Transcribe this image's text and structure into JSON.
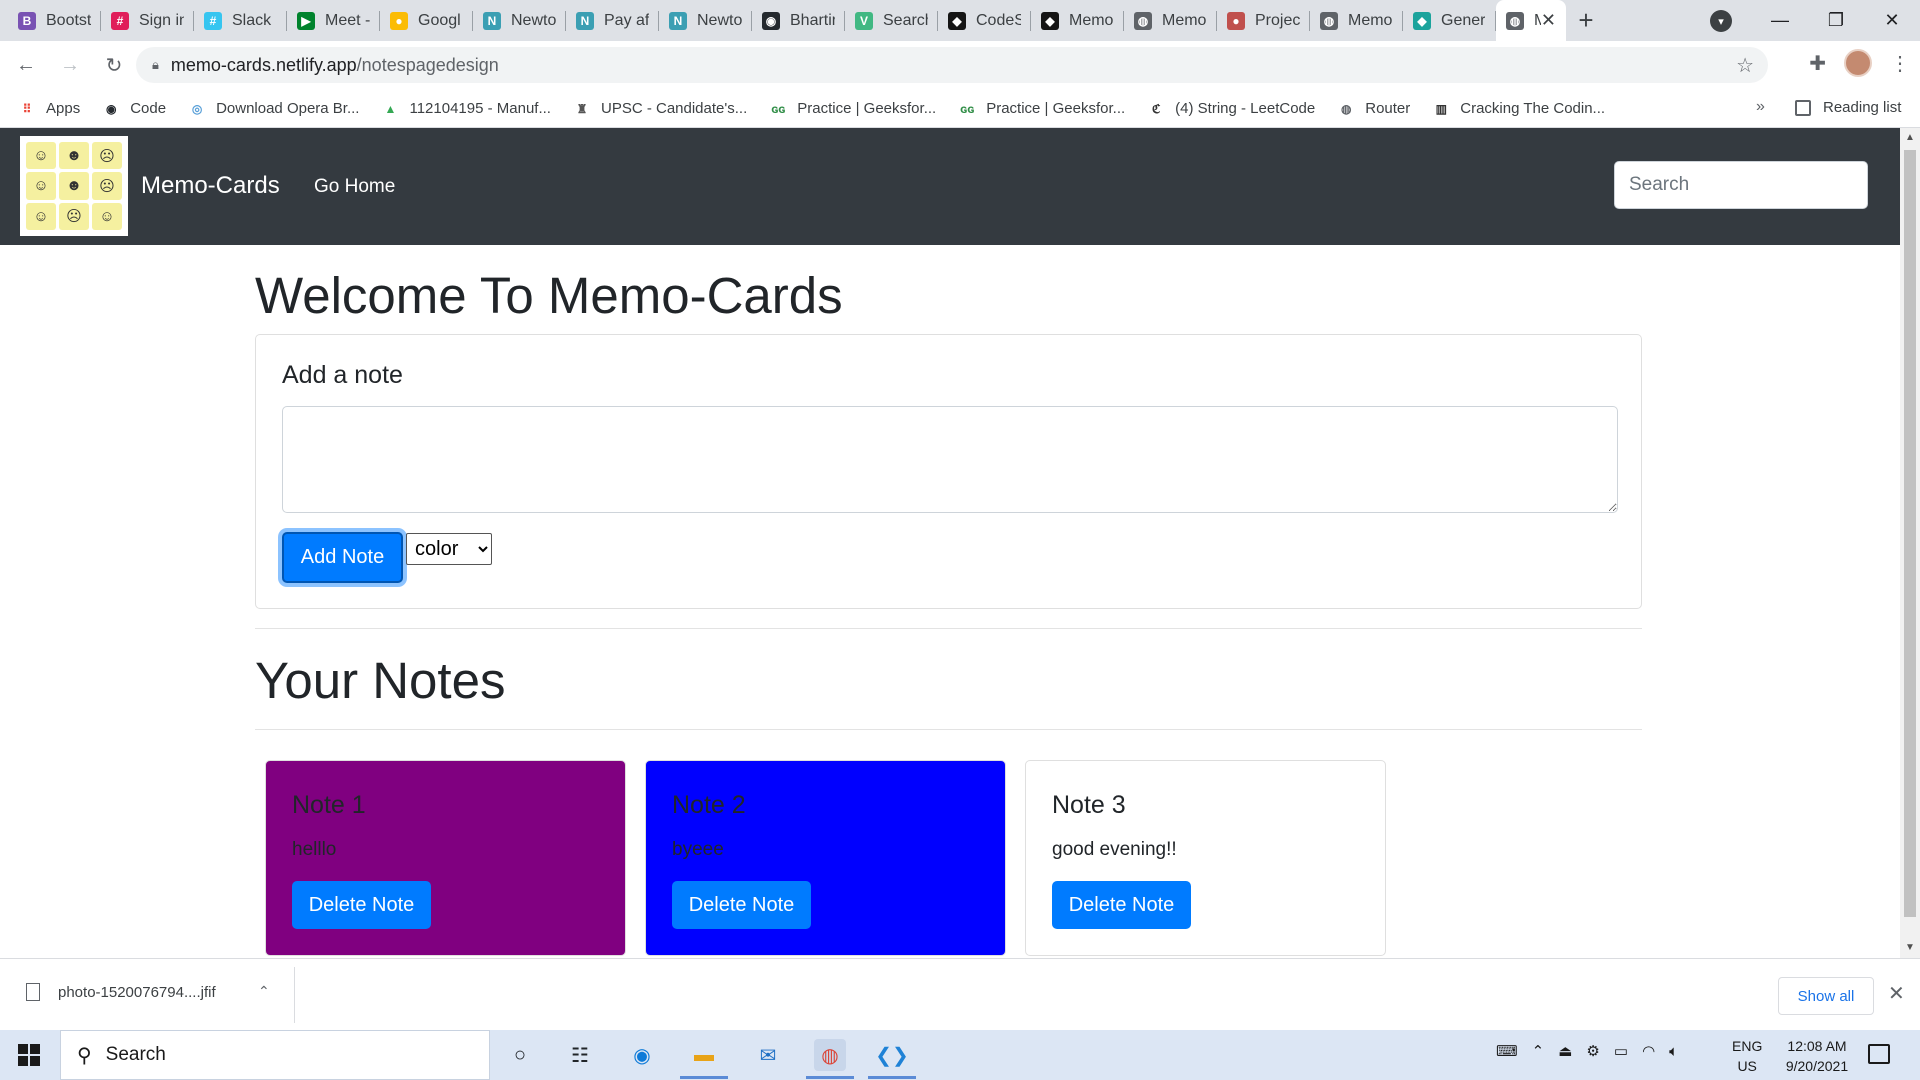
{
  "browser": {
    "tabs": [
      {
        "title": "Bootst",
        "icon": "bootstrap-icon",
        "color": "#7952b3",
        "glyph": "B"
      },
      {
        "title": "Sign in",
        "icon": "slack-icon",
        "color": "#e01e5a",
        "glyph": "#"
      },
      {
        "title": "Slack |",
        "icon": "slack-icon",
        "color": "#36c5f0",
        "glyph": "#"
      },
      {
        "title": "Meet -",
        "icon": "meet-icon",
        "color": "#00832d",
        "glyph": "▶"
      },
      {
        "title": "Googl",
        "icon": "google-keep-icon",
        "color": "#fbbc04",
        "glyph": "●"
      },
      {
        "title": "Newto",
        "icon": "newton-icon",
        "color": "#3b9fb3",
        "glyph": "N"
      },
      {
        "title": "Pay aft",
        "icon": "newton-icon",
        "color": "#3b9fb3",
        "glyph": "N"
      },
      {
        "title": "Newto",
        "icon": "newton-icon",
        "color": "#3b9fb3",
        "glyph": "N"
      },
      {
        "title": "Bhartir",
        "icon": "github-icon",
        "color": "#24292e",
        "glyph": "◉"
      },
      {
        "title": "Search",
        "icon": "vue-icon",
        "color": "#41b883",
        "glyph": "V"
      },
      {
        "title": "CodeS",
        "icon": "codesandbox-icon",
        "color": "#151515",
        "glyph": "◆"
      },
      {
        "title": "Memo",
        "icon": "codesandbox-icon",
        "color": "#151515",
        "glyph": "◆"
      },
      {
        "title": "Memo",
        "icon": "globe-icon",
        "color": "#5f6368",
        "glyph": "◍"
      },
      {
        "title": "Projec",
        "icon": "avatar-icon",
        "color": "#c0504d",
        "glyph": "●"
      },
      {
        "title": "Memo",
        "icon": "globe-icon",
        "color": "#5f6368",
        "glyph": "◍"
      },
      {
        "title": "Gener",
        "icon": "diamond-icon",
        "color": "#1ba39c",
        "glyph": "◆"
      }
    ],
    "active_tab": {
      "title": "Me",
      "icon": "globe-icon",
      "color": "#5f6368",
      "glyph": "◍"
    },
    "url_host": "memo-cards.netlify.app",
    "url_path": "/notespagedesign",
    "bookmarks": [
      {
        "label": "Apps",
        "icon": "apps-grid-icon",
        "color": "#ea4335",
        "glyph": "⠿"
      },
      {
        "label": "Code",
        "icon": "github-icon",
        "color": "#24292e",
        "glyph": "◉"
      },
      {
        "label": "Download Opera Br...",
        "icon": "opera-icon",
        "color": "#5aa0d8",
        "glyph": "◎"
      },
      {
        "label": "112104195 - Manuf...",
        "icon": "google-drive-icon",
        "color": "#34a853",
        "glyph": "▲"
      },
      {
        "label": "UPSC - Candidate's...",
        "icon": "emblem-icon",
        "color": "#555555",
        "glyph": "♜"
      },
      {
        "label": "Practice | Geeksfor...",
        "icon": "geeksforgeeks-icon",
        "color": "#2f8d46",
        "glyph": "ɢɢ"
      },
      {
        "label": "Practice | Geeksfor...",
        "icon": "geeksforgeeks-icon",
        "color": "#2f8d46",
        "glyph": "ɢɢ"
      },
      {
        "label": "(4) String - LeetCode",
        "icon": "leetcode-icon",
        "color": "#333333",
        "glyph": "ℭ"
      },
      {
        "label": "Router",
        "icon": "globe-icon",
        "color": "#5f6368",
        "glyph": "◍"
      },
      {
        "label": "Cracking The Codin...",
        "icon": "book-icon",
        "color": "#333333",
        "glyph": "▥"
      }
    ],
    "bookmarks_more": "»",
    "reading_list": "Reading list"
  },
  "site": {
    "brand": "Memo-Cards",
    "nav_link": "Go Home",
    "search_placeholder": "Search",
    "logo_faces": [
      "☺",
      "☻",
      "☹",
      "☺",
      "☻",
      "☹",
      "☺",
      "☹",
      "☺"
    ],
    "page_title": "Welcome To Memo-Cards",
    "add_note_heading": "Add a note",
    "textarea_value": "",
    "add_button": "Add Note",
    "color_select": "color",
    "notes_heading": "Your Notes",
    "notes": [
      {
        "title": "Note 1",
        "text": "helllo",
        "bg": "#800080",
        "delete_label": "Delete Note"
      },
      {
        "title": "Note 2",
        "text": "byeee",
        "bg": "#0000ff",
        "delete_label": "Delete Note"
      },
      {
        "title": "Note 3",
        "text": "good evening!!",
        "bg": "#ffffff",
        "delete_label": "Delete Note"
      }
    ]
  },
  "downloads": {
    "file": "photo-1520076794....jfif",
    "show_all": "Show all"
  },
  "taskbar": {
    "search": "Search",
    "lang_top": "ENG",
    "lang_bottom": "US",
    "time": "12:08 AM",
    "date": "9/20/2021"
  }
}
